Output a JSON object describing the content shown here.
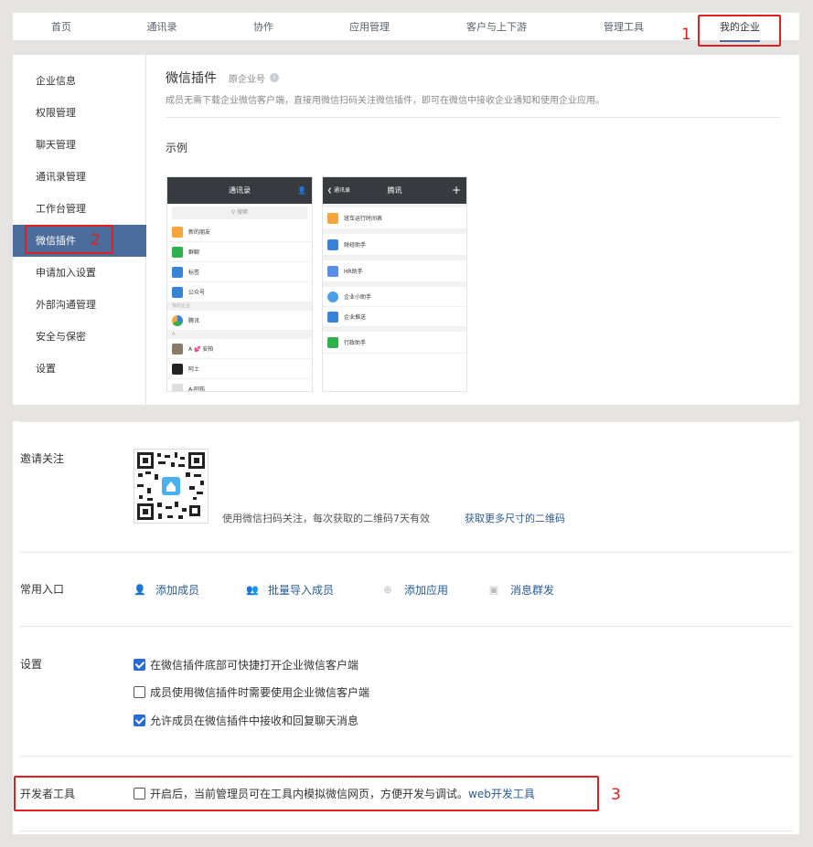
{
  "topnav": {
    "tabs": [
      "首页",
      "通讯录",
      "协作",
      "应用管理",
      "客户与上下游",
      "管理工具",
      "我的企业"
    ],
    "annotation": "1"
  },
  "sidebar": {
    "items": [
      "企业信息",
      "权限管理",
      "聊天管理",
      "通讯录管理",
      "工作台管理",
      "微信插件",
      "申请加入设置",
      "外部沟通管理",
      "安全与保密",
      "设置"
    ],
    "annotation": "2"
  },
  "plugin": {
    "title": "微信插件",
    "origin": "原企业号",
    "info_icon": "i",
    "description": "成员无需下载企业微信客户端，直接用微信扫码关注微信插件，即可在微信中接收企业通知和使用企业应用。",
    "example_label": "示例"
  },
  "phone1": {
    "header": "通讯录",
    "search": "搜索",
    "rows": [
      "新的朋友",
      "群聊",
      "标签",
      "公众号"
    ],
    "section": "我的企业",
    "company": "腾讯",
    "letter": "A",
    "contacts": [
      "A 💕 安柏",
      "阿土",
      "A-阿布"
    ]
  },
  "phone2": {
    "header": "腾讯",
    "back": "通讯录",
    "rows": [
      "班车运行时间表",
      "财经助手",
      "HR助手",
      "企业小助手",
      "企业推送",
      "行政助手"
    ]
  },
  "invite": {
    "label": "邀请关注",
    "text": "使用微信扫码关注，每次获取的二维码7天有效",
    "link": "获取更多尺寸的二维码"
  },
  "entries": {
    "label": "常用入口",
    "items": [
      "添加成员",
      "批量导入成员",
      "添加应用",
      "消息群发"
    ]
  },
  "settings": {
    "label": "设置",
    "options": [
      {
        "text": "在微信插件底部可快捷打开企业微信客户端",
        "checked": true
      },
      {
        "text": "成员使用微信插件时需要使用企业微信客户端",
        "checked": false
      },
      {
        "text": "允许成员在微信插件中接收和回复聊天消息",
        "checked": true
      }
    ]
  },
  "devtools": {
    "label": "开发者工具",
    "text": "开启后，当前管理员可在工具内模拟微信网页，方便开发与调试。",
    "link": "web开发工具",
    "checked": false,
    "annotation": "3"
  },
  "colors": {
    "accent": "#4a6d9c",
    "link": "#2a5a94",
    "annotation": "#e02020",
    "checkbox": "#2a6ad4"
  }
}
